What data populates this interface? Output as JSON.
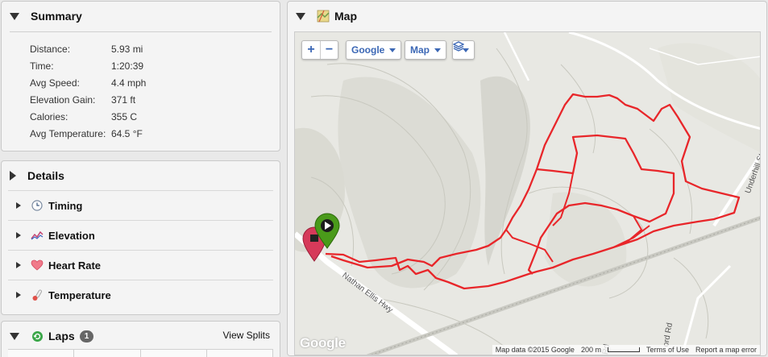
{
  "summary": {
    "title": "Summary",
    "rows": [
      {
        "label": "Distance:",
        "value": "5.93 mi"
      },
      {
        "label": "Time:",
        "value": "1:20:39"
      },
      {
        "label": "Avg Speed:",
        "value": "4.4 mph"
      },
      {
        "label": "Elevation Gain:",
        "value": "371 ft"
      },
      {
        "label": "Calories:",
        "value": "355 C"
      },
      {
        "label": "Avg Temperature:",
        "value": "64.5 °F"
      }
    ]
  },
  "details": {
    "title": "Details",
    "items": [
      {
        "label": "Timing",
        "icon": "clock-icon"
      },
      {
        "label": "Elevation",
        "icon": "elevation-chart-icon"
      },
      {
        "label": "Heart Rate",
        "icon": "heart-icon"
      },
      {
        "label": "Temperature",
        "icon": "thermometer-icon"
      }
    ]
  },
  "laps": {
    "title": "Laps",
    "count": "1",
    "view_splits": "View Splits"
  },
  "map": {
    "title": "Map",
    "zoom_in": "+",
    "zoom_out": "−",
    "provider": "Google",
    "type": "Map",
    "logo": "Google",
    "attribution": {
      "data": "Map data ©2015 Google",
      "scale": "200 m",
      "terms": "Terms of Use",
      "report": "Report a map error"
    },
    "roads": {
      "main": "Nathan Ellis Hwy",
      "right": "Underhill St",
      "bottom": "Rd",
      "bottom2": "ord Rd"
    },
    "colors": {
      "track": "#e8262a",
      "start_pin": "#4a9a1a",
      "end_pin": "#d63a5a"
    }
  }
}
